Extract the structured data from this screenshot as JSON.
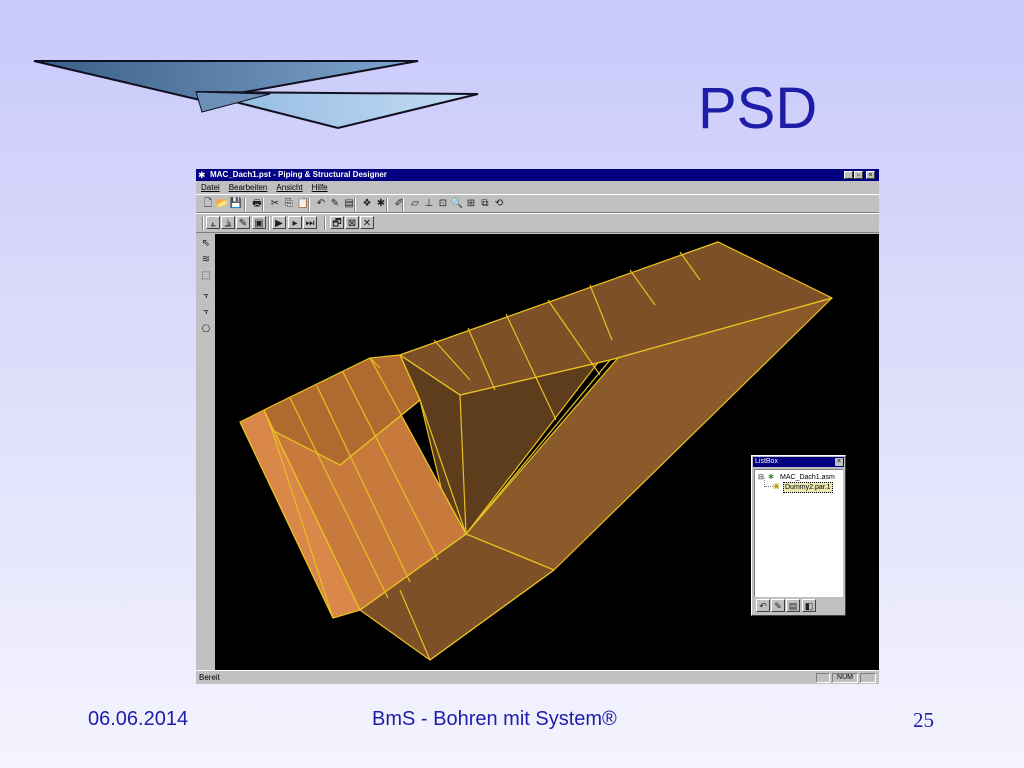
{
  "slide": {
    "title": "PSD",
    "footer": {
      "date": "06.06.2014",
      "center": "BmS - Bohren mit System®",
      "page": "25"
    }
  },
  "window": {
    "title": "MAC_Dach1.pst - Piping & Structural Designer",
    "controls": {
      "minimize": "_",
      "maximize": "▫",
      "close": "×"
    },
    "menu": [
      {
        "label": "Datei"
      },
      {
        "label": "Bearbeiten"
      },
      {
        "label": "Ansicht"
      },
      {
        "label": "Hilfe"
      }
    ],
    "toolbar1": [
      {
        "icon": "new-icon",
        "glyph": "🗋"
      },
      {
        "icon": "open-icon",
        "glyph": "📂"
      },
      {
        "icon": "save-icon",
        "glyph": "💾"
      },
      {
        "icon": "print-icon",
        "glyph": "🖶"
      },
      {
        "icon": "cut-icon",
        "glyph": "✂"
      },
      {
        "icon": "copy-icon",
        "glyph": "⎘"
      },
      {
        "icon": "paste-icon",
        "glyph": "📋"
      },
      {
        "icon": "undo-icon",
        "glyph": "↶"
      },
      {
        "icon": "pencil-icon",
        "glyph": "✎"
      },
      {
        "icon": "layers-icon",
        "glyph": "▤"
      },
      {
        "icon": "component-icon",
        "glyph": "❖"
      },
      {
        "icon": "assembly-icon",
        "glyph": "✱"
      },
      {
        "icon": "paint-icon",
        "glyph": "✐"
      },
      {
        "icon": "box-icon",
        "glyph": "▱"
      },
      {
        "icon": "axis-icon",
        "glyph": "⊥"
      },
      {
        "icon": "zoom-window-icon",
        "glyph": "⊡"
      },
      {
        "icon": "zoom-icon",
        "glyph": "🔍"
      },
      {
        "icon": "zoom-all-icon",
        "glyph": "⊞"
      },
      {
        "icon": "views-icon",
        "glyph": "⧉"
      },
      {
        "icon": "refresh-icon",
        "glyph": "⟲"
      }
    ],
    "toolbar2": [
      {
        "icon": "pipe-tool-1-icon",
        "glyph": "⫠"
      },
      {
        "icon": "pipe-tool-2-icon",
        "glyph": "⫡"
      },
      {
        "icon": "edit-pipe-icon",
        "glyph": "✎"
      },
      {
        "icon": "structure-icon",
        "glyph": "▣"
      },
      {
        "icon": "play-icon",
        "glyph": "▶"
      },
      {
        "icon": "step-icon",
        "glyph": "▸"
      },
      {
        "icon": "forward-icon",
        "glyph": "⏭"
      },
      {
        "icon": "window-settings-icon",
        "glyph": "🗗"
      },
      {
        "icon": "edit-window-icon",
        "glyph": "⊠"
      },
      {
        "icon": "delete-icon",
        "glyph": "✕"
      }
    ],
    "lefttools": [
      {
        "icon": "select-arrow-icon",
        "glyph": "⇖"
      },
      {
        "icon": "profile-icon",
        "glyph": "≋"
      },
      {
        "icon": "solid-icon",
        "glyph": "⬚"
      },
      {
        "icon": "flange-1-icon",
        "glyph": "⫟"
      },
      {
        "icon": "flange-2-icon",
        "glyph": "⫟"
      },
      {
        "icon": "insert-part-icon",
        "glyph": "⎔"
      }
    ],
    "status": {
      "text": "Bereit",
      "num": "NUM"
    }
  },
  "listbox": {
    "title": "ListBox",
    "close": "×",
    "items": [
      {
        "label": "MAC_Dach1.asm",
        "expander": "⊟"
      },
      {
        "label": "Dummy2.par.1"
      }
    ],
    "tools": [
      {
        "icon": "undo-icon",
        "glyph": "↶"
      },
      {
        "icon": "pencil-icon",
        "glyph": "✎"
      },
      {
        "icon": "layers-icon",
        "glyph": "▤"
      },
      {
        "icon": "part-icon",
        "glyph": "◧"
      }
    ]
  },
  "colors": {
    "title_blue": "#1d1da8",
    "model_fill": "#8a5a2a",
    "model_edges": "#e8c020",
    "window_titlebar": "#000080"
  }
}
